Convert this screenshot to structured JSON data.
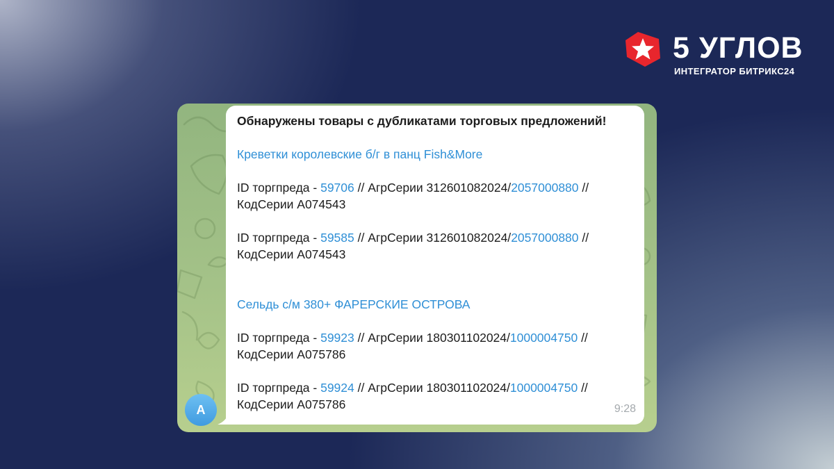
{
  "brand": {
    "name": "5 УГЛОВ",
    "tagline": "ИНТЕГРАТОР БИТРИКС24",
    "logo_icon": "red-pentagon-star-icon",
    "accent_color": "#e8262d"
  },
  "chat": {
    "avatar_letter": "A",
    "avatar_color": "#4aa6e6",
    "message": {
      "title": "Обнаружены товары с дубликатами торговых предложений!",
      "groups": [
        {
          "product": "Креветки королевские б/г в панц Fish&More",
          "offers": [
            {
              "prefix": "ID торгпреда - ",
              "id": "59706",
              "batch_text": " // АгрСерии 312601082024/",
              "batch_link": "2057000880",
              "suffix": " //",
              "code": "КодСерии А074543"
            },
            {
              "prefix": "ID торгпреда - ",
              "id": "59585",
              "batch_text": " // АгрСерии 312601082024/",
              "batch_link": "2057000880",
              "suffix": " //",
              "code": "КодСерии А074543"
            }
          ]
        },
        {
          "product": "Сельдь с/м 380+ ФАРЕРСКИЕ ОСТРОВА",
          "offers": [
            {
              "prefix": "ID торгпреда - ",
              "id": "59923",
              "batch_text": " // АгрСерии 180301102024/",
              "batch_link": "1000004750",
              "suffix": " //",
              "code": "КодСерии А075786"
            },
            {
              "prefix": "ID торгпреда - ",
              "id": "59924",
              "batch_text": " // АгрСерии 180301102024/",
              "batch_link": "1000004750",
              "suffix": " //",
              "code": "КодСерии А075786"
            }
          ]
        }
      ],
      "time": "9:28"
    },
    "link_color": "#2f8fd6",
    "background_color": "#a4c288"
  }
}
